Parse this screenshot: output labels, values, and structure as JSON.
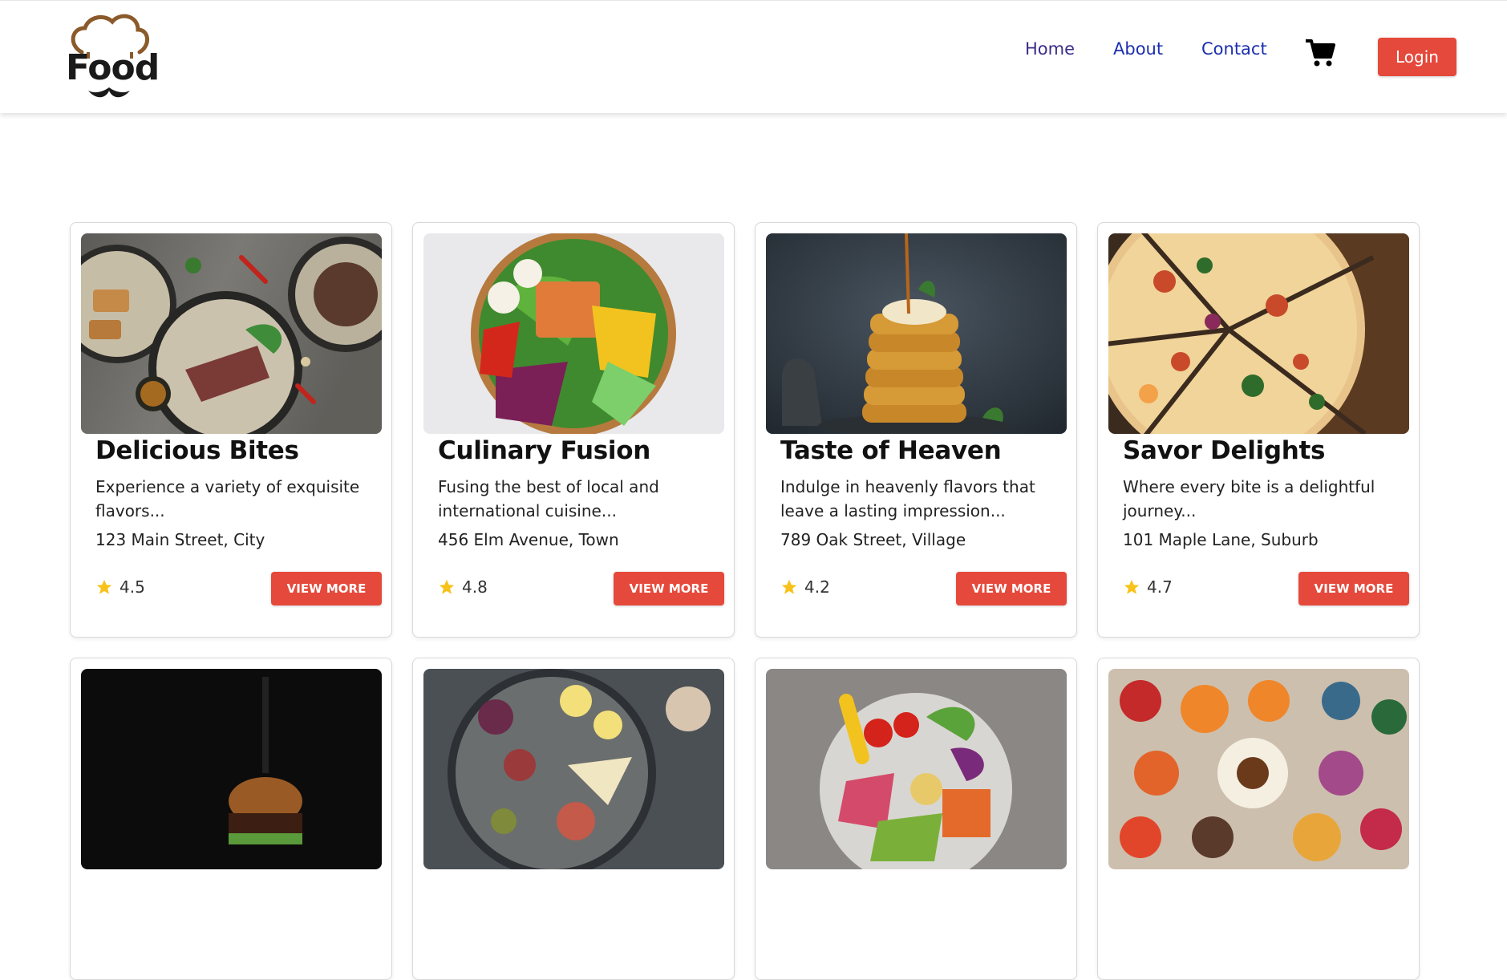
{
  "brand": {
    "logo_text": "Food"
  },
  "nav": {
    "home": "Home",
    "about": "About",
    "contact": "Contact",
    "cart_icon": "shopping-cart-icon",
    "login": "Login"
  },
  "colors": {
    "accent": "#e5493b",
    "star": "#f7c21a",
    "nav_link": "#1c2fae"
  },
  "restaurants": [
    {
      "name": "Delicious Bites",
      "description": "Experience a variety of exquisite flavors...",
      "address": "123 Main Street, City",
      "rating": "4.5",
      "button": "VIEW MORE"
    },
    {
      "name": "Culinary Fusion",
      "description": "Fusing the best of local and international cuisine...",
      "address": "456 Elm Avenue, Town",
      "rating": "4.8",
      "button": "VIEW MORE"
    },
    {
      "name": "Taste of Heaven",
      "description": "Indulge in heavenly flavors that leave a lasting impression...",
      "address": "789 Oak Street, Village",
      "rating": "4.2",
      "button": "VIEW MORE"
    },
    {
      "name": "Savor Delights",
      "description": "Where every bite is a delightful journey...",
      "address": "101 Maple Lane, Suburb",
      "rating": "4.7",
      "button": "VIEW MORE"
    }
  ]
}
